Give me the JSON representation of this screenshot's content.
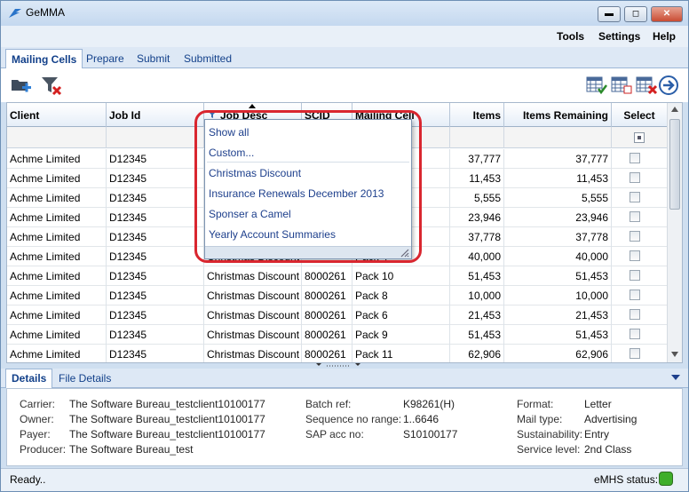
{
  "window": {
    "title": "GeMMA",
    "minimize": "▬",
    "maximize": "◻",
    "close": "✕"
  },
  "menu": {
    "tools": "Tools",
    "settings": "Settings",
    "help": "Help"
  },
  "tabs": {
    "mailing_cells": "Mailing Cells",
    "prepare": "Prepare",
    "submit": "Submit",
    "submitted": "Submitted"
  },
  "grid": {
    "headers": {
      "client": "Client",
      "job_id": "Job Id",
      "job_desc": "Job Desc",
      "scid": "SCID",
      "mailing_cell": "Mailing Cell",
      "items": "Items",
      "items_remaining": "Items Remaining",
      "select": "Select"
    },
    "rows": [
      {
        "client": "Achme Limited",
        "job_id": "D12345",
        "job_desc": "",
        "scid": "",
        "mailing_cell": "",
        "items": "37,777",
        "items_remaining": "37,777"
      },
      {
        "client": "Achme Limited",
        "job_id": "D12345",
        "job_desc": "",
        "scid": "",
        "mailing_cell": "",
        "items": "11,453",
        "items_remaining": "11,453"
      },
      {
        "client": "Achme Limited",
        "job_id": "D12345",
        "job_desc": "",
        "scid": "",
        "mailing_cell": "",
        "items": "5,555",
        "items_remaining": "5,555"
      },
      {
        "client": "Achme Limited",
        "job_id": "D12345",
        "job_desc": "",
        "scid": "",
        "mailing_cell": "",
        "items": "23,946",
        "items_remaining": "23,946"
      },
      {
        "client": "Achme Limited",
        "job_id": "D12345",
        "job_desc": "",
        "scid": "",
        "mailing_cell": "",
        "items": "37,778",
        "items_remaining": "37,778"
      },
      {
        "client": "Achme Limited",
        "job_id": "D12345",
        "job_desc": "Christmas Discount",
        "scid": "",
        "mailing_cell": "Pack 4",
        "items": "40,000",
        "items_remaining": "40,000"
      },
      {
        "client": "Achme Limited",
        "job_id": "D12345",
        "job_desc": "Christmas Discount",
        "scid": "8000261",
        "mailing_cell": "Pack 10",
        "items": "51,453",
        "items_remaining": "51,453"
      },
      {
        "client": "Achme Limited",
        "job_id": "D12345",
        "job_desc": "Christmas Discount",
        "scid": "8000261",
        "mailing_cell": "Pack 8",
        "items": "10,000",
        "items_remaining": "10,000"
      },
      {
        "client": "Achme Limited",
        "job_id": "D12345",
        "job_desc": "Christmas Discount",
        "scid": "8000261",
        "mailing_cell": "Pack 6",
        "items": "21,453",
        "items_remaining": "21,453"
      },
      {
        "client": "Achme Limited",
        "job_id": "D12345",
        "job_desc": "Christmas Discount",
        "scid": "8000261",
        "mailing_cell": "Pack 9",
        "items": "51,453",
        "items_remaining": "51,453"
      },
      {
        "client": "Achme Limited",
        "job_id": "D12345",
        "job_desc": "Christmas Discount",
        "scid": "8000261",
        "mailing_cell": "Pack 11",
        "items": "62,906",
        "items_remaining": "62,906"
      }
    ]
  },
  "filter_dropdown": {
    "show_all": "Show all",
    "custom": "Custom...",
    "options": [
      "Christmas Discount",
      "Insurance Renewals December 2013",
      "Sponser a Camel",
      "Yearly Account Summaries"
    ]
  },
  "details_tabs": {
    "details": "Details",
    "file_details": "File Details"
  },
  "details": {
    "carrier_label": "Carrier:",
    "carrier": "The Software Bureau_testclient10100177",
    "owner_label": "Owner:",
    "owner": "The Software Bureau_testclient10100177",
    "payer_label": "Payer:",
    "payer": "The Software Bureau_testclient10100177",
    "producer_label": "Producer:",
    "producer": "The Software Bureau_test",
    "batch_ref_label": "Batch ref:",
    "batch_ref": "K98261(H)",
    "seq_label": "Sequence no range:",
    "seq": "1..6646",
    "sap_label": "SAP acc no:",
    "sap": "S10100177",
    "format_label": "Format:",
    "format": "Letter",
    "mail_type_label": "Mail type:",
    "mail_type": "Advertising",
    "sustainability_label": "Sustainability:",
    "sustainability": "Entry",
    "service_level_label": "Service level:",
    "service_level": "2nd Class"
  },
  "status": {
    "text": "Ready..",
    "emhs_label": "eMHS status:",
    "emhs_color": "#3fae2a"
  },
  "colors": {
    "accent": "#12408a",
    "highlight": "#d9262f"
  }
}
